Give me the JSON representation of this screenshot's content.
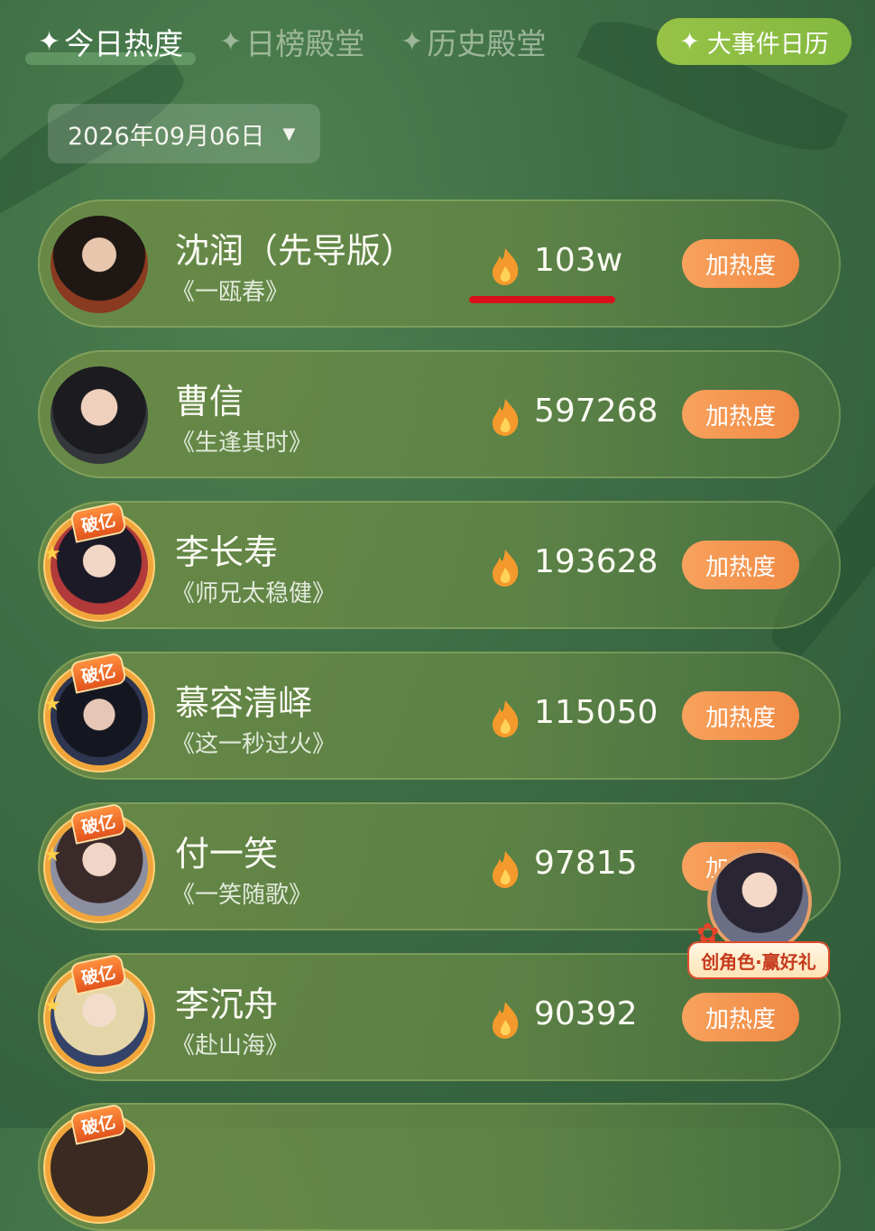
{
  "tabs": [
    {
      "label": "今日热度",
      "active": true
    },
    {
      "label": "日榜殿堂",
      "active": false
    },
    {
      "label": "历史殿堂",
      "active": false
    }
  ],
  "tab_icon": "sparkle-icon",
  "calendar_button": {
    "label": "大事件日历"
  },
  "date_select": {
    "value": "2026年09月06日"
  },
  "rows": [
    {
      "name": "沈润（先导版）",
      "work": "《一瓯春》",
      "heat": "103w",
      "button": "加热度",
      "badge": null,
      "underlined": true
    },
    {
      "name": "曹信",
      "work": "《生逢其时》",
      "heat": "597268",
      "button": "加热度",
      "badge": null
    },
    {
      "name": "李长寿",
      "work": "《师兄太稳健》",
      "heat": "193628",
      "button": "加热度",
      "badge": "破亿"
    },
    {
      "name": "慕容清峄",
      "work": "《这一秒过火》",
      "heat": "115050",
      "button": "加热度",
      "badge": "破亿"
    },
    {
      "name": "付一笑",
      "work": "《一笑随歌》",
      "heat": "97815",
      "button": "加热度",
      "badge": "破亿"
    },
    {
      "name": "李沉舟",
      "work": "《赴山海》",
      "heat": "90392",
      "button": "加热度",
      "badge": "破亿"
    },
    {
      "badge": "破亿"
    }
  ],
  "promo": {
    "label": "创角色·赢好礼"
  },
  "colors": {
    "accent_green": "#8fbf44",
    "button_orange": "#f39450",
    "underline_red": "#d9111a"
  }
}
